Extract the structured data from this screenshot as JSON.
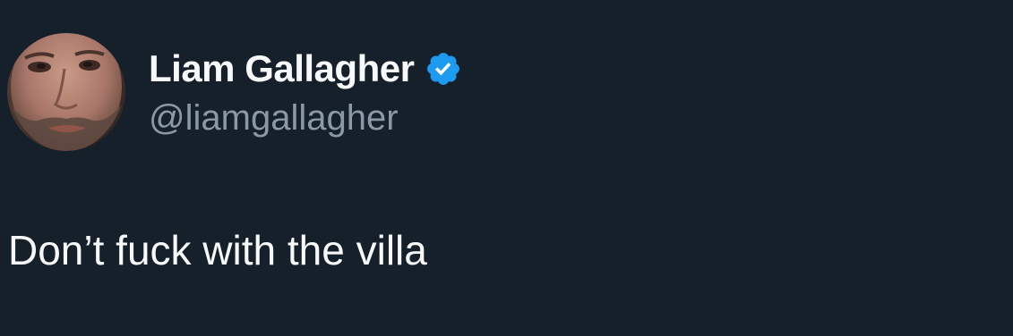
{
  "author": {
    "display_name": "Liam Gallagher",
    "handle": "@liamgallagher",
    "verified": true,
    "avatar_icon": "profile-photo"
  },
  "tweet": {
    "text": "Don’t fuck with the villa"
  },
  "colors": {
    "background": "#15202b",
    "text_primary": "#f7f9f9",
    "text_secondary": "#8b98a5",
    "verified_badge": "#1d9bf0"
  }
}
